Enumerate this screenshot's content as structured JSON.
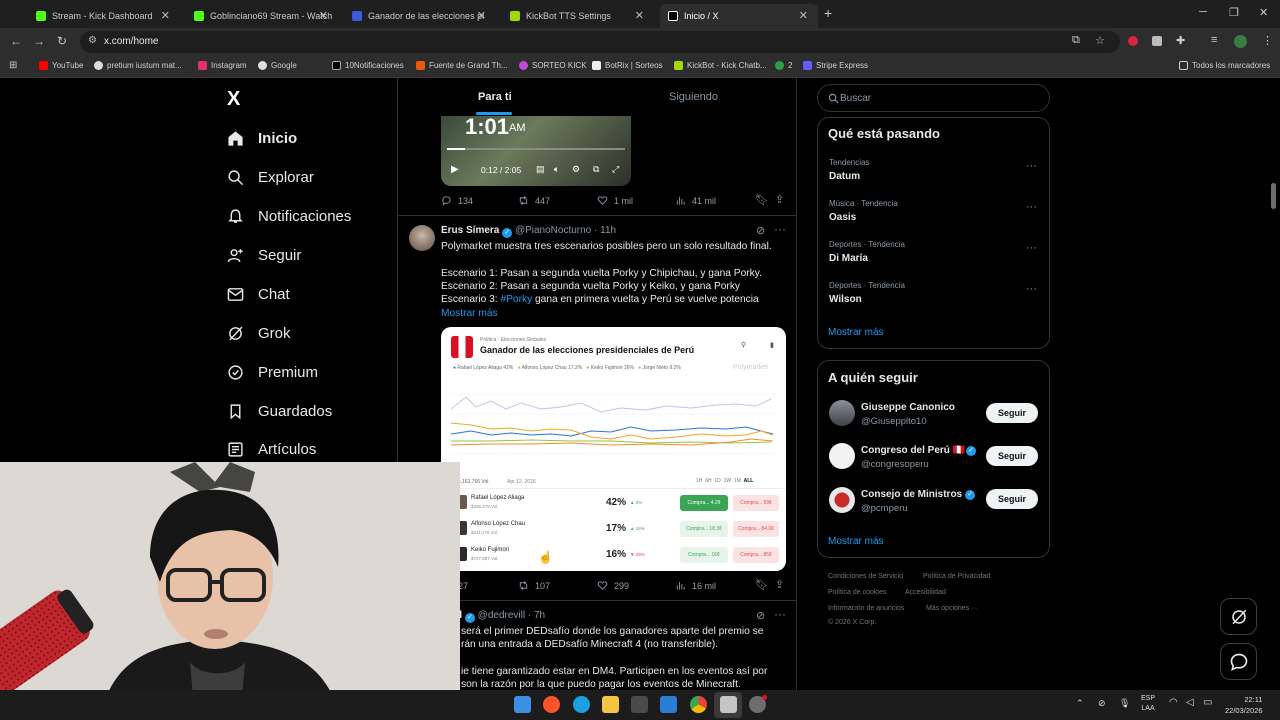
{
  "browser": {
    "tabs": [
      {
        "title": "Stream - Kick Dashboard",
        "color": "#53fc18"
      },
      {
        "title": "Goblinciano69 Stream - Watch",
        "color": "#53fc18"
      },
      {
        "title": "Ganador de las elecciones pres",
        "color": "#3b5bdb"
      },
      {
        "title": "KickBot TTS Settings",
        "color": "#a3d900"
      },
      {
        "title": "Inicio / X",
        "color": "#ffffff"
      }
    ],
    "new_tab": "+",
    "url": "x.com/home",
    "bookmarks": [
      "YouTube",
      "pretium iustum mat...",
      "Instagram",
      "Google",
      "10Notificaciones",
      "Fuente de Grand Th...",
      "SORTEO KICK",
      "BotRix | Sorteos",
      "KickBot - Kick Chatb...",
      "2",
      "Stripe Express"
    ],
    "all_bookmarks": "Todos los marcadores"
  },
  "sidebar": {
    "logo": "X",
    "items": [
      {
        "label": "Inicio",
        "icon": "home-icon"
      },
      {
        "label": "Explorar",
        "icon": "search-icon"
      },
      {
        "label": "Notificaciones",
        "icon": "bell-icon"
      },
      {
        "label": "Seguir",
        "icon": "person-add-icon"
      },
      {
        "label": "Chat",
        "icon": "mail-icon"
      },
      {
        "label": "Grok",
        "icon": "grok-icon"
      },
      {
        "label": "Premium",
        "icon": "verified-icon"
      },
      {
        "label": "Guardados",
        "icon": "bookmark-icon"
      },
      {
        "label": "Artículos",
        "icon": "article-icon"
      }
    ]
  },
  "feed": {
    "tabs": [
      "Para ti",
      "Siguiendo"
    ],
    "video": {
      "time_overlay": "1:01",
      "ampm": "AM",
      "progress": "0:12 / 2:05"
    },
    "tweet0_actions": {
      "replies": "134",
      "reposts": "447",
      "likes": "1 mil",
      "views": "41 mil"
    },
    "tweet1": {
      "name": "Erus Símera",
      "handle": "@PianoNocturno",
      "time": "· 11h",
      "lines": [
        "Polymarket muestra tres escenarios posibles pero un solo resultado final.",
        "",
        "Escenario 1: Pasan a segunda vuelta Porky y Chipichau, y gana Porky.",
        "Escenario 2: Pasan a segunda vuelta Porky y Keiko, y gana Porky"
      ],
      "line4_prefix": "Escenario 3: ",
      "line4_hashtag": "#Porky",
      "line4_suffix": " gana en primera vuelta y Perú se vuelve potencia",
      "show_more": "Mostrar más",
      "card": {
        "breadcrumb": "Política · Elecciones Globales",
        "title": "Ganador de las elecciones presidenciales de Perú",
        "brand": "Polymarket",
        "legend": [
          "Rafael López Aliaga 42%",
          "Alfonso López Chau 17.2%",
          "Keiko Fujimori 16%",
          "Jorge Nieto 9.2%"
        ],
        "volume": "$3,163,766 Vol.",
        "date": "Apr 12, 2026",
        "ranges": [
          "1H",
          "6H",
          "1D",
          "1W",
          "1M",
          "ALL"
        ],
        "rows": [
          {
            "name": "Rafael López Aliaga",
            "vol": "$336,478 Vol.",
            "pct": "42%",
            "delta": "▲ 2%",
            "yes": "Compra... 4.2¢",
            "no": "Compra... 59¢"
          },
          {
            "name": "Alfonso López Chau",
            "vol": "$311,178 Vol.",
            "pct": "17%",
            "delta": "▲ 16%",
            "yes": "Compra... 18.3¢",
            "no": "Compra... 84.0¢"
          },
          {
            "name": "Keiko Fujimori",
            "vol": "$727,867 Vol.",
            "pct": "16%",
            "delta": "▼ 28%",
            "yes": "Compra... 16¢",
            "no": "Compra... 85¢"
          }
        ]
      },
      "actions": {
        "replies": "27",
        "reposts": "107",
        "likes": "299",
        "views": "16 mil"
      }
    },
    "tweet2": {
      "name": "d",
      "handle": "@dedrevill",
      "time": "· 7h",
      "lines": [
        "será el primer DEDsafío donde los ganadores aparte del premio se",
        "rán una entrada a DEDsafío Minecraft 4 (no transferible).",
        "",
        "ie tiene garantizado estar en DM4. Participen en los eventos así por",
        "son la razón por la que puedo pagar los eventos de Minecraft."
      ]
    }
  },
  "right": {
    "search_placeholder": "Buscar",
    "trends_title": "Qué está pasando",
    "trends": [
      {
        "category": "Tendencias",
        "name": "Datum"
      },
      {
        "category": "Música · Tendencia",
        "name": "Oasis"
      },
      {
        "category": "Deportes · Tendencia",
        "name": "Di María"
      },
      {
        "category": "Deportes · Tendencia",
        "name": "Wilson"
      }
    ],
    "show_more": "Mostrar más",
    "follow_title": "A quién seguir",
    "follow": [
      {
        "name": "Giuseppe Canonico",
        "handle": "@Giusepplto10",
        "button": "Seguir"
      },
      {
        "name": "Congreso del Perú 🇵🇪",
        "handle": "@congresoperu",
        "button": "Seguir"
      },
      {
        "name": "Consejo de Ministros",
        "handle": "@pcmperu",
        "button": "Seguir"
      }
    ],
    "follow_more": "Mostrar más",
    "footer": [
      "Condiciones de Servicio",
      "Política de Privacidad",
      "Política de cookies",
      "Accesibilidad",
      "Información de anuncios",
      "Más opciones ···",
      "© 2026 X Corp."
    ]
  },
  "taskbar": {
    "lang1": "ESP",
    "lang2": "LAA",
    "time": "22:11",
    "date": "22/03/2026"
  }
}
